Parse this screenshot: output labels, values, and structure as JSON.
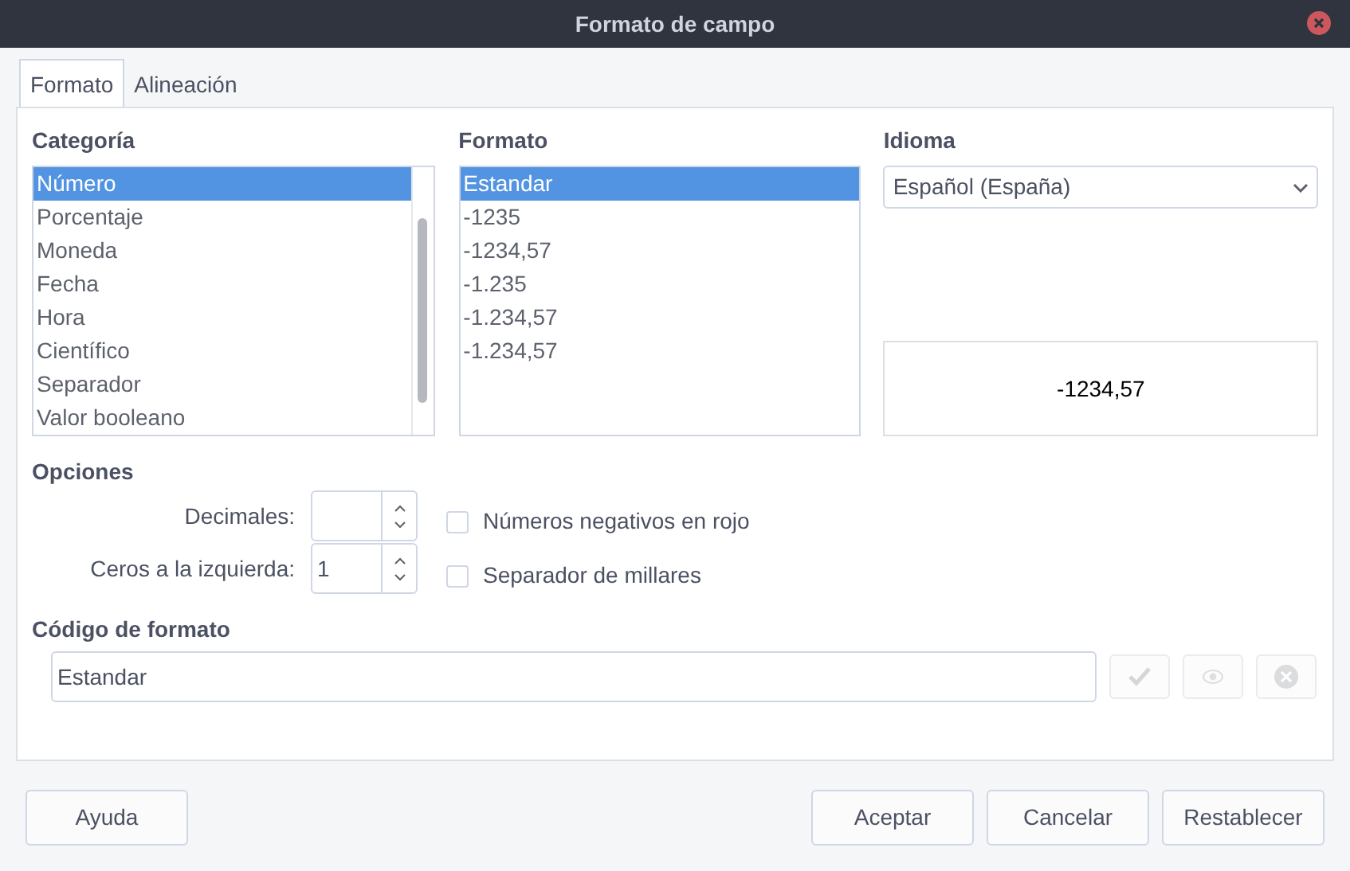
{
  "window": {
    "title": "Formato de campo"
  },
  "tabs": [
    {
      "label": "Formato",
      "selected": true
    },
    {
      "label": "Alineación",
      "selected": false
    }
  ],
  "category": {
    "label": "Categoría",
    "items": [
      {
        "label": "Número",
        "selected": true
      },
      {
        "label": "Porcentaje",
        "selected": false
      },
      {
        "label": "Moneda",
        "selected": false
      },
      {
        "label": "Fecha",
        "selected": false
      },
      {
        "label": "Hora",
        "selected": false
      },
      {
        "label": "Científico",
        "selected": false
      },
      {
        "label": "Separador",
        "selected": false
      },
      {
        "label": "Valor booleano",
        "selected": false
      }
    ]
  },
  "format": {
    "label": "Formato",
    "items": [
      {
        "label": "Estandar",
        "selected": true
      },
      {
        "label": "-1235",
        "selected": false
      },
      {
        "label": "-1234,57",
        "selected": false
      },
      {
        "label": "-1.235",
        "selected": false
      },
      {
        "label": "-1.234,57",
        "selected": false
      },
      {
        "label": "-1.234,57",
        "selected": false
      }
    ]
  },
  "language": {
    "label": "Idioma",
    "value": "Español (España)"
  },
  "preview": "-1234,57",
  "options": {
    "label": "Opciones",
    "spinners": [
      {
        "label": "Decimales:"
      },
      {
        "label": "Ceros a la izquierda:",
        "value": "1"
      }
    ],
    "checkboxes": [
      {
        "label": "Números negativos en rojo",
        "checked": false
      },
      {
        "label": "Separador de millares",
        "checked": false
      }
    ]
  },
  "format_code": {
    "label": "Código de formato",
    "value": "Estandar",
    "buttons": [
      {
        "kind": "accept",
        "disabled": true
      },
      {
        "kind": "comment",
        "disabled": true
      },
      {
        "kind": "delete",
        "disabled": true
      }
    ]
  },
  "footer": {
    "help": "Ayuda",
    "buttons": [
      "Aceptar",
      "Cancelar",
      "Restablecer"
    ]
  }
}
